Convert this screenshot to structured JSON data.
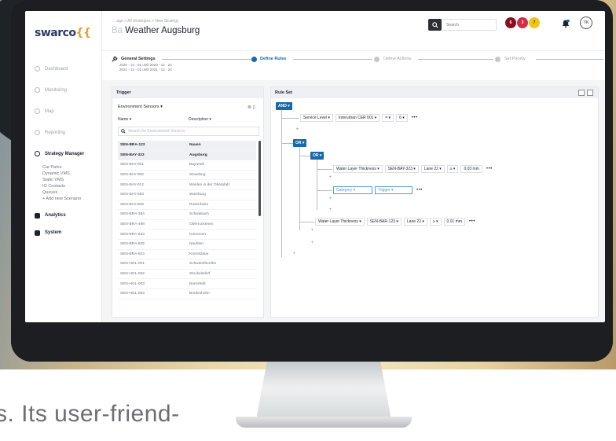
{
  "tagline": "s. Its user-friend-",
  "app": {
    "logo_main": "swarco",
    "logo_suffix": "{{",
    "breadcrumbs": "… age  >  All Strategies  >  New Strategy",
    "title_prefix": "Ba",
    "title": "Weather Augsburg"
  },
  "sidebar": {
    "items": [
      {
        "label": "Dashboard"
      },
      {
        "label": "Monitoring"
      },
      {
        "label": "Map"
      },
      {
        "label": "Reporting"
      },
      {
        "label": "Strategy Manager"
      }
    ],
    "sub_items": [
      "Car Parks",
      "Dynamic VMS",
      "Static VMS",
      "IO Contacts",
      "Queues",
      "+ Add new Scenario"
    ],
    "analytics": "Analytics",
    "system": "System"
  },
  "header": {
    "search_placeholder": "Search",
    "badges": [
      "6",
      "3",
      "7"
    ],
    "avatar": "TK"
  },
  "stepper": {
    "general_settings": "General Settings",
    "date_line_1": "2020 - 12 - 01 until 2020 - 12 - 24",
    "date_line_2": "2021 - 12 - 01 until 2021 - 12 - 24",
    "steps": [
      "Define Rules",
      "Define Actions",
      "Set Priority"
    ],
    "active_step": "Define Rules"
  },
  "trigger": {
    "heading": "Trigger",
    "source_select": "Environment Sensors ▾",
    "columns": [
      "Name ▾",
      "Description ▾"
    ],
    "search_placeholder": "Search for Environment Sensors",
    "rows": [
      {
        "name": "SEN-BRA-123",
        "desc": "Nauen",
        "selected": true
      },
      {
        "name": "SEN-BAY-323",
        "desc": "Augsburg",
        "selected": true
      },
      {
        "name": "SEN-BAY-001",
        "desc": "Bayreuth",
        "selected": false
      },
      {
        "name": "SEN-BAY-002",
        "desc": "Straubing",
        "selected": false
      },
      {
        "name": "SEN-BAY-012",
        "desc": "Weiden in der Oberpfalz",
        "selected": false
      },
      {
        "name": "SEN-BAY-093",
        "desc": "Würzburg",
        "selected": false
      },
      {
        "name": "SEN-BAY-808",
        "desc": "Rosenheim",
        "selected": false
      },
      {
        "name": "SEN-BRA-384",
        "desc": "Schwabach",
        "selected": false
      },
      {
        "name": "SEN-BRA-498",
        "desc": "Oberruckenen",
        "selected": false
      },
      {
        "name": "SEN-BRA-833",
        "desc": "Kremmen",
        "selected": false
      },
      {
        "name": "SEN-BRA-925",
        "desc": "Nauhlen",
        "selected": false
      },
      {
        "name": "SEN-BRA-923",
        "desc": "Kremitzaue",
        "selected": false
      },
      {
        "name": "SEN-HOL-001",
        "desc": "Schweinthenthe",
        "selected": false
      },
      {
        "name": "SEN-HOL-002",
        "desc": "Stockelsdorf",
        "selected": false
      },
      {
        "name": "SEN-HOL-003",
        "desc": "Barnstedt",
        "selected": false
      },
      {
        "name": "SEN-HOL-004",
        "desc": "Bordesholm",
        "selected": false
      }
    ]
  },
  "ruleset": {
    "heading": "Rule Set",
    "op_and": "AND ▾",
    "op_or1": "OR ▾",
    "op_or2": "OR ▾",
    "rule1": [
      "Service Level ▾",
      "Interurban CER 001 ▾",
      "= ▾",
      "6 ▾"
    ],
    "rule2": [
      "Water Layer Thickness ▾",
      "SEN-BAY-323 ▾",
      "Lane 22 ▾",
      "≥ ▾",
      "0.03 mm"
    ],
    "rule3": [
      "Category ▾",
      "Trigger ▾"
    ],
    "rule4": [
      "Water Layer Thickness ▾",
      "SEN-BAR-123 ▾",
      "Lane 22 ▾",
      "≥ ▾",
      "0.01 mm"
    ],
    "more": "•••"
  },
  "colors": {
    "accent": "#1769aa",
    "badge_dark_red": "#8b0f1c",
    "badge_red": "#d12f46",
    "badge_yellow": "#f0c419"
  }
}
